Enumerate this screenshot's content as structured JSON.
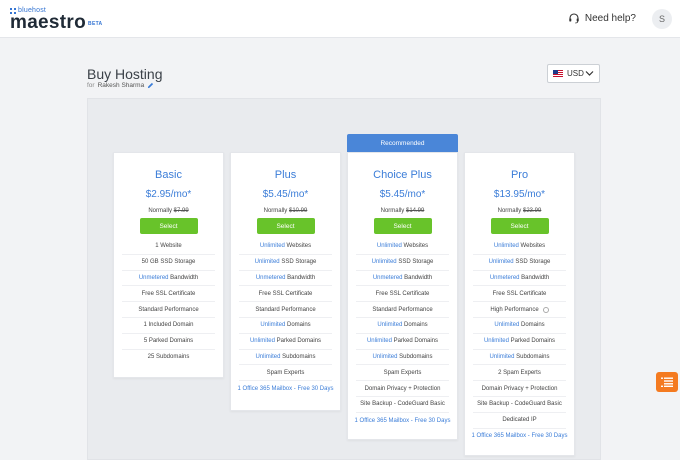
{
  "header": {
    "logo_small": "bluehost",
    "logo_big": "maestro",
    "logo_badge": "BETA",
    "help_label": "Need help?",
    "avatar_initial": "S"
  },
  "page": {
    "title": "Buy Hosting",
    "for_label": "for",
    "customer_name": "Rakesh Sharma"
  },
  "currency": {
    "selected": "USD"
  },
  "recommended_label": "Recommended",
  "plans": [
    {
      "name": "Basic",
      "price": "$2.95/mo*",
      "normally_label": "Normally",
      "normal_price": "$7.99",
      "select_label": "Select",
      "features": [
        {
          "hl": "",
          "text": "1 Website"
        },
        {
          "hl": "",
          "text": "50 GB SSD Storage"
        },
        {
          "hl": "Unmetered",
          "text": " Bandwidth"
        },
        {
          "hl": "",
          "text": "Free SSL Certificate"
        },
        {
          "hl": "",
          "text": "Standard Performance"
        },
        {
          "hl": "",
          "text": "1 Included Domain"
        },
        {
          "hl": "",
          "text": "5 Parked Domains"
        },
        {
          "hl": "",
          "text": "25 Subdomains"
        }
      ]
    },
    {
      "name": "Plus",
      "price": "$5.45/mo*",
      "normally_label": "Normally",
      "normal_price": "$10.99",
      "select_label": "Select",
      "features": [
        {
          "hl": "Unlimited",
          "text": " Websites"
        },
        {
          "hl": "Unlimited",
          "text": " SSD Storage"
        },
        {
          "hl": "Unmetered",
          "text": " Bandwidth"
        },
        {
          "hl": "",
          "text": "Free SSL Certificate"
        },
        {
          "hl": "",
          "text": "Standard Performance"
        },
        {
          "hl": "Unlimited",
          "text": " Domains"
        },
        {
          "hl": "Unlimited",
          "text": " Parked Domains"
        },
        {
          "hl": "Unlimited",
          "text": " Subdomains"
        },
        {
          "hl": "",
          "text": "Spam Experts"
        },
        {
          "hl": "1 Office 365 Mailbox - Free 30 Days",
          "text": ""
        }
      ]
    },
    {
      "name": "Choice Plus",
      "price": "$5.45/mo*",
      "normally_label": "Normally",
      "normal_price": "$14.99",
      "select_label": "Select",
      "features": [
        {
          "hl": "Unlimited",
          "text": " Websites"
        },
        {
          "hl": "Unlimited",
          "text": " SSD Storage"
        },
        {
          "hl": "Unmetered",
          "text": " Bandwidth"
        },
        {
          "hl": "",
          "text": "Free SSL Certificate"
        },
        {
          "hl": "",
          "text": "Standard Performance"
        },
        {
          "hl": "Unlimited",
          "text": " Domains"
        },
        {
          "hl": "Unlimited",
          "text": " Parked Domains"
        },
        {
          "hl": "Unlimited",
          "text": " Subdomains"
        },
        {
          "hl": "",
          "text": "Spam Experts"
        },
        {
          "hl": "",
          "text": "Domain Privacy + Protection"
        },
        {
          "hl": "",
          "text": "Site Backup - CodeGuard Basic"
        },
        {
          "hl": "1 Office 365 Mailbox - Free 30 Days",
          "text": ""
        }
      ]
    },
    {
      "name": "Pro",
      "price": "$13.95/mo*",
      "normally_label": "Normally",
      "normal_price": "$23.99",
      "select_label": "Select",
      "features": [
        {
          "hl": "Unlimited",
          "text": " Websites"
        },
        {
          "hl": "Unlimited",
          "text": " SSD Storage"
        },
        {
          "hl": "Unmetered",
          "text": " Bandwidth"
        },
        {
          "hl": "",
          "text": "Free SSL Certificate"
        },
        {
          "hl": "",
          "text": "High Performance",
          "info": true
        },
        {
          "hl": "Unlimited",
          "text": " Domains"
        },
        {
          "hl": "Unlimited",
          "text": " Parked Domains"
        },
        {
          "hl": "Unlimited",
          "text": " Subdomains"
        },
        {
          "hl": "",
          "text": "2 Spam Experts"
        },
        {
          "hl": "",
          "text": "Domain Privacy + Protection"
        },
        {
          "hl": "",
          "text": "Site Backup - CodeGuard Basic"
        },
        {
          "hl": "",
          "text": "Dedicated IP"
        },
        {
          "hl": "1 Office 365 Mailbox - Free 30 Days",
          "text": ""
        }
      ]
    }
  ],
  "colors": {
    "accent": "#3b7dd8",
    "select": "#68c32a",
    "fab": "#f47a20"
  }
}
